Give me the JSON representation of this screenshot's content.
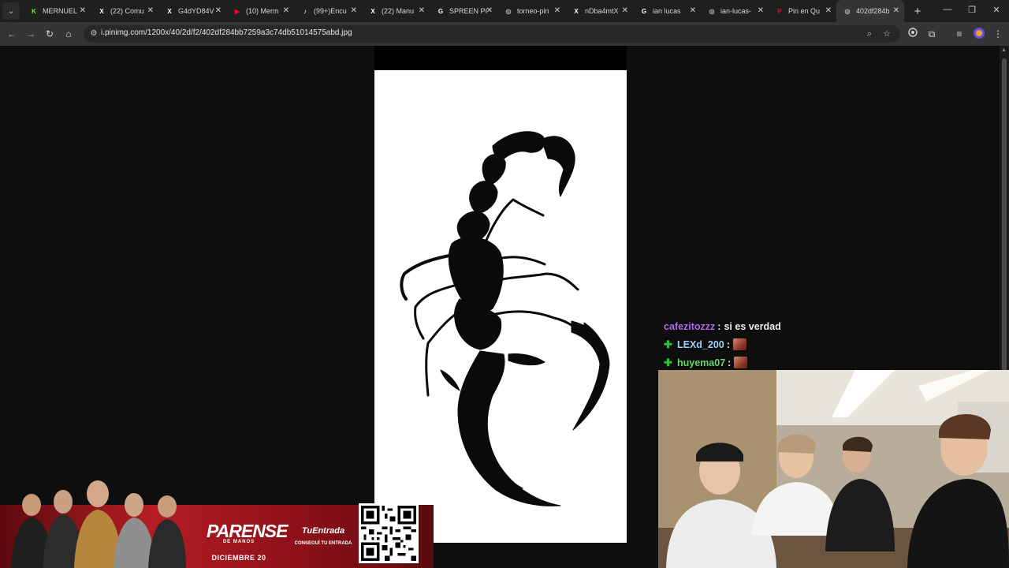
{
  "browser": {
    "tabs": [
      {
        "title": "MERNUEL",
        "icon": "kick-icon",
        "color": "#53fc18",
        "glyph": "K"
      },
      {
        "title": "(22) Comu",
        "icon": "x-icon",
        "color": "#ffffff",
        "glyph": "X"
      },
      {
        "title": "G4dYD84V",
        "icon": "x-icon",
        "color": "#ffffff",
        "glyph": "X"
      },
      {
        "title": "(10) Merm",
        "icon": "youtube-icon",
        "color": "#ff0033",
        "glyph": "▶"
      },
      {
        "title": "(99+)Encu",
        "icon": "tiktok-icon",
        "color": "#ffffff",
        "glyph": "♪"
      },
      {
        "title": "(22) Manu",
        "icon": "x-icon",
        "color": "#ffffff",
        "glyph": "X"
      },
      {
        "title": "SPREEN PC",
        "icon": "google-icon",
        "color": "#ffffff",
        "glyph": "G"
      },
      {
        "title": "torneo-pin",
        "icon": "globe-icon",
        "color": "#bdbdbd",
        "glyph": "◎"
      },
      {
        "title": "nDba4mtX",
        "icon": "x-icon",
        "color": "#ffffff",
        "glyph": "X"
      },
      {
        "title": "ian lucas",
        "icon": "google-icon",
        "color": "#ffffff",
        "glyph": "G"
      },
      {
        "title": "ian-lucas-",
        "icon": "globe-icon",
        "color": "#bdbdbd",
        "glyph": "◎"
      },
      {
        "title": "Pin en Qu",
        "icon": "pinterest-icon",
        "color": "#e60023",
        "glyph": "P"
      },
      {
        "title": "402df284b",
        "icon": "globe-icon",
        "color": "#bdbdbd",
        "glyph": "◎",
        "active": true
      }
    ],
    "close_glyph": "✕",
    "new_tab_glyph": "+",
    "window": {
      "minimize": "—",
      "restore": "❐",
      "close": "✕"
    },
    "nav": {
      "back": "←",
      "forward": "→",
      "reload": "↻",
      "home": "⌂"
    },
    "url": "i.pinimg.com/1200x/40/2d/f2/402df284bb7259a3c74db51014575abd.jpg",
    "site_info_glyph": "⚙",
    "zoom_glyph": "⌕",
    "bookmark_glyph": "☆",
    "extension_glyph": "⧉",
    "media_glyph": "≡"
  },
  "chat": [
    {
      "user": "cafezitozzz",
      "color": "#b46bf0",
      "separator": ":",
      "message": "si es verdad",
      "badge": false,
      "emote": false
    },
    {
      "user": "LEXd_200",
      "color": "#9ad4ff",
      "separator": ":",
      "message": "",
      "badge": true,
      "emote": true
    },
    {
      "user": "huyema07",
      "color": "#6bd66b",
      "separator": ":",
      "message": "",
      "badge": true,
      "emote": true
    }
  ],
  "banner": {
    "logo": "PARENSE",
    "logo_sub": "DE MANOS",
    "date": "DICIEMBRE 20",
    "brand": "TuEntrada",
    "cta": "CONSEGUÍ TU ENTRADA"
  },
  "colors": {
    "page_bg": "#0e0e0e",
    "image_bg": "#ffffff",
    "banner_red": "#b51d24"
  }
}
